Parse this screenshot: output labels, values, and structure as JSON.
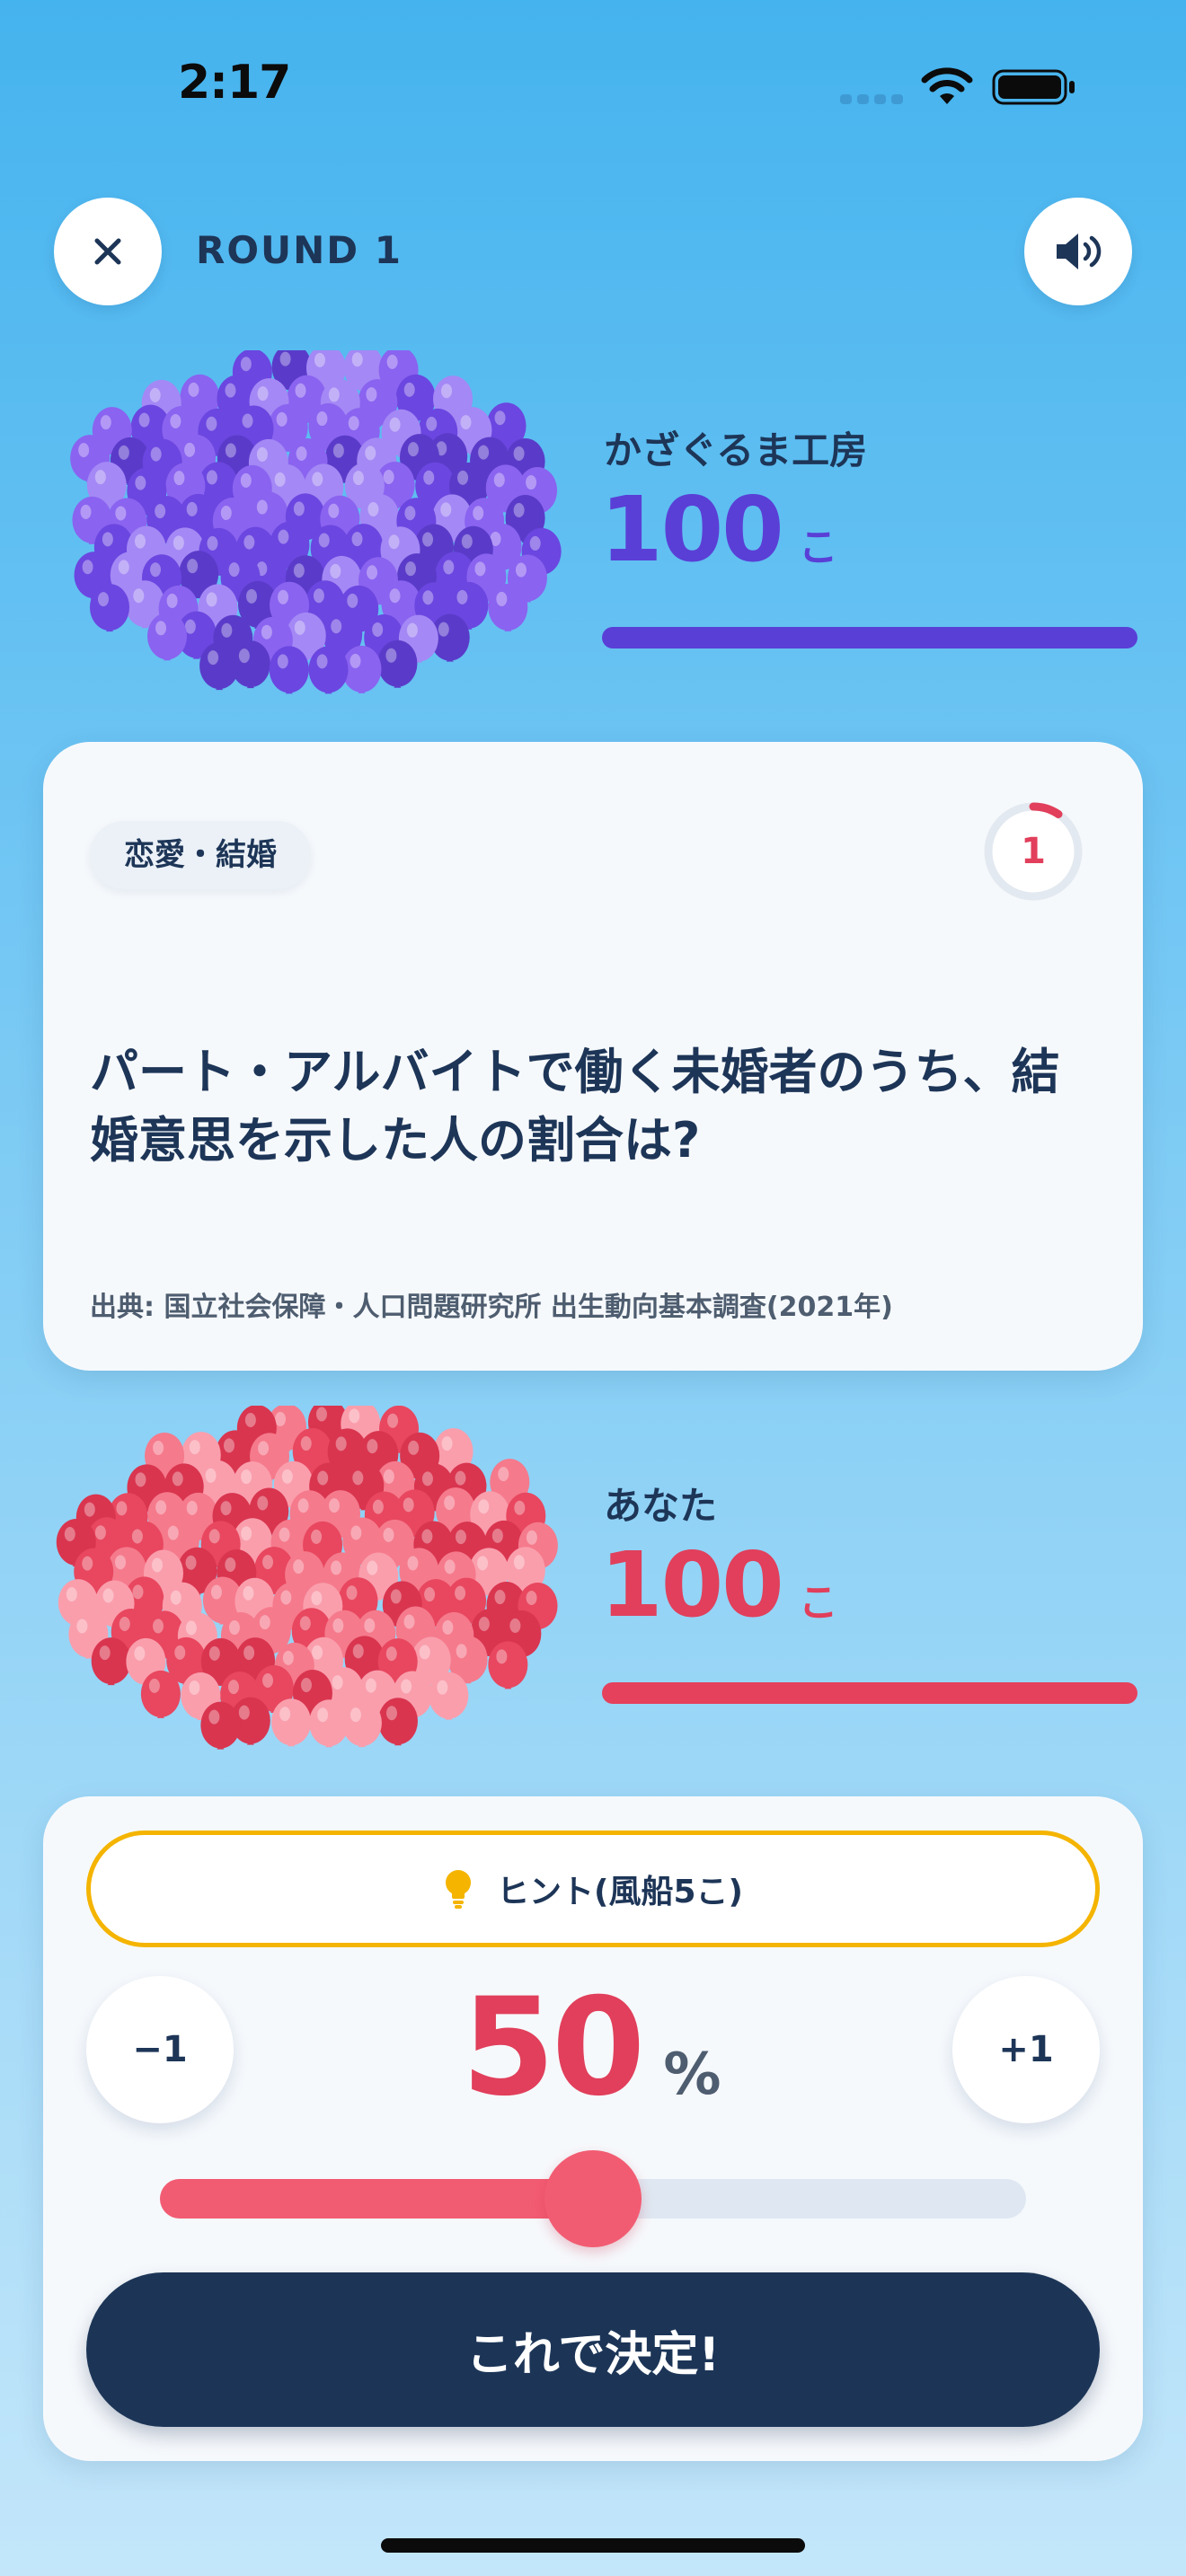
{
  "status_bar": {
    "time": "2:17",
    "icons": [
      "signal-dots-icon",
      "wifi-icon",
      "battery-icon"
    ]
  },
  "header": {
    "round_label": "ROUND 1",
    "close_icon": "close-icon",
    "sound_icon": "speaker-icon"
  },
  "cpu_player": {
    "name": "かざぐるま工房",
    "balloons": "100",
    "unit": "こ",
    "color": "#5a3fd6",
    "balloon_colors": [
      "#8a63f0",
      "#6b46e0",
      "#a488f5",
      "#5a3bc9"
    ]
  },
  "question": {
    "category": "恋愛・結婚",
    "timer": "1",
    "text": "パート・アルバイトで働く未婚者のうち、結婚意思を示した人の割合は?",
    "source": "出典: 国立社会保障・人口問題研究所 出生動向基本調査(2021年)"
  },
  "player": {
    "name": "あなた",
    "balloons": "100",
    "unit": "こ",
    "color": "#e13f5b",
    "balloon_colors": [
      "#f57a8c",
      "#e8475f",
      "#fa9eac",
      "#d9354f"
    ]
  },
  "answer": {
    "hint_label": "ヒント(風船5こ)",
    "hint_icon": "lightbulb-icon",
    "minus_label": "−1",
    "plus_label": "+1",
    "percent_value": "50",
    "percent_unit": "%",
    "slider_fraction": 0.5,
    "confirm_label": "これで決定!",
    "accent_color": "#f25c72",
    "hint_border_color": "#f4b400",
    "button_color": "#1c3557"
  }
}
